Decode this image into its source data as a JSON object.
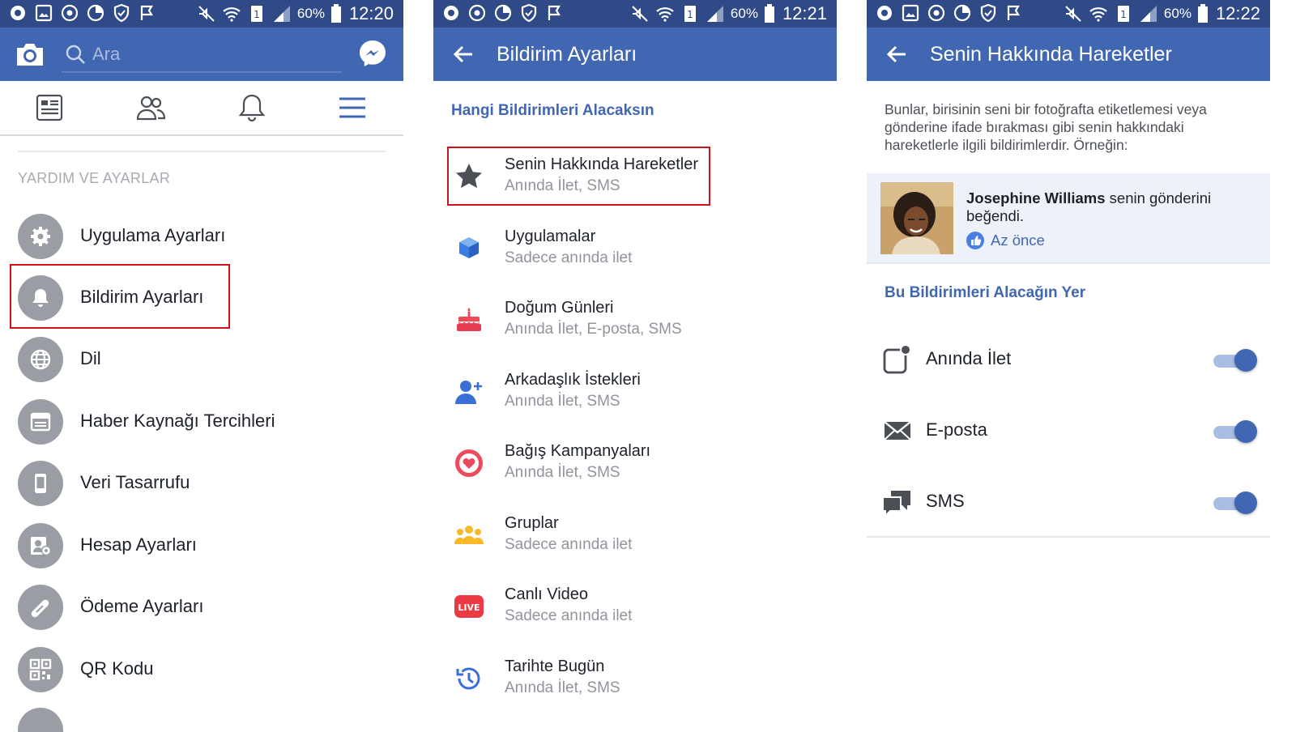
{
  "panel1": {
    "status": {
      "battery": "60%",
      "time": "12:20"
    },
    "search_placeholder": "Ara",
    "section_header": "YARDIM VE AYARLAR",
    "menu_items": [
      {
        "label": "Uygulama Ayarları",
        "icon": "gear-icon"
      },
      {
        "label": "Bildirim Ayarları",
        "icon": "bell-icon"
      },
      {
        "label": "Dil",
        "icon": "globe-icon"
      },
      {
        "label": "Haber Kaynağı Tercihleri",
        "icon": "newsfeed-icon"
      },
      {
        "label": "Veri Tasarrufu",
        "icon": "phone-icon"
      },
      {
        "label": "Hesap Ayarları",
        "icon": "account-icon"
      },
      {
        "label": "Ödeme Ayarları",
        "icon": "payment-icon"
      },
      {
        "label": "QR Kodu",
        "icon": "qr-code-icon"
      }
    ]
  },
  "panel2": {
    "status": {
      "battery": "60%",
      "time": "12:21"
    },
    "title": "Bildirim Ayarları",
    "section_header": "Hangi Bildirimleri Alacaksın",
    "items": [
      {
        "title": "Senin Hakkında Hareketler",
        "subtitle": "Anında İlet, SMS",
        "icon": "star-icon"
      },
      {
        "title": "Uygulamalar",
        "subtitle": "Sadece anında ilet",
        "icon": "cube-icon"
      },
      {
        "title": "Doğum Günleri",
        "subtitle": "Anında İlet, E-posta, SMS",
        "icon": "cake-icon"
      },
      {
        "title": "Arkadaşlık İstekleri",
        "subtitle": "Anında İlet, SMS",
        "icon": "add-friend-icon"
      },
      {
        "title": "Bağış Kampanyaları",
        "subtitle": "Anında İlet, SMS",
        "icon": "heart-donation-icon"
      },
      {
        "title": "Gruplar",
        "subtitle": "Sadece anında ilet",
        "icon": "groups-icon"
      },
      {
        "title": "Canlı Video",
        "subtitle": "Sadece anında ilet",
        "icon": "live-video-icon",
        "badge": "LIVE"
      },
      {
        "title": "Tarihte Bugün",
        "subtitle": "Anında İlet, SMS",
        "icon": "history-icon"
      }
    ]
  },
  "panel3": {
    "status": {
      "battery": "60%",
      "time": "12:22"
    },
    "title": "Senin Hakkında Hareketler",
    "description": "Bunlar, birisinin seni bir fotoğrafta etiketlemesi veya gönderine ifade bırakması gibi senin hakkındaki hareketlerle ilgili bildirimlerdir. Örneğin:",
    "example": {
      "name": "Josephine Williams",
      "text": " senin gönderini beğendi.",
      "time": "Az önce"
    },
    "channels_header": "Bu Bildirimleri Alacağın Yer",
    "channels": [
      {
        "label": "Anında İlet",
        "icon": "push-notification-icon",
        "enabled": true
      },
      {
        "label": "E-posta",
        "icon": "envelope-icon",
        "enabled": true
      },
      {
        "label": "SMS",
        "icon": "sms-icon",
        "enabled": true
      }
    ]
  },
  "colors": {
    "header": "#4267b2",
    "statusbar": "#2f4a87",
    "highlight": "#d0101a",
    "accent": "#4267b2"
  }
}
